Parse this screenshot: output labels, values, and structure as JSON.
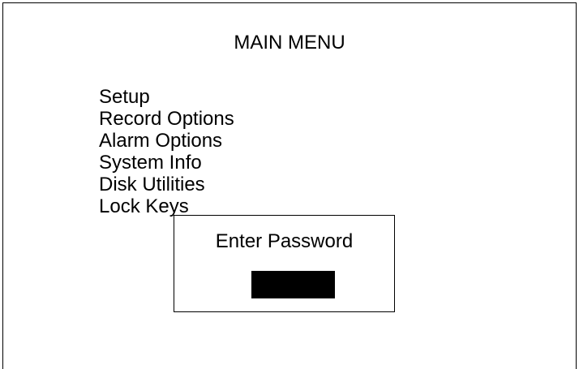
{
  "main_menu": {
    "title": "MAIN MENU",
    "items": [
      {
        "label": "Setup"
      },
      {
        "label": "Record Options"
      },
      {
        "label": "Alarm Options"
      },
      {
        "label": "System Info"
      },
      {
        "label": "Disk Utilities"
      },
      {
        "label": "Lock Keys"
      }
    ]
  },
  "password_dialog": {
    "title": "Enter Password",
    "value": ""
  },
  "colors": {
    "background": "#ffffff",
    "foreground": "#000000",
    "password_field": "#000000"
  }
}
